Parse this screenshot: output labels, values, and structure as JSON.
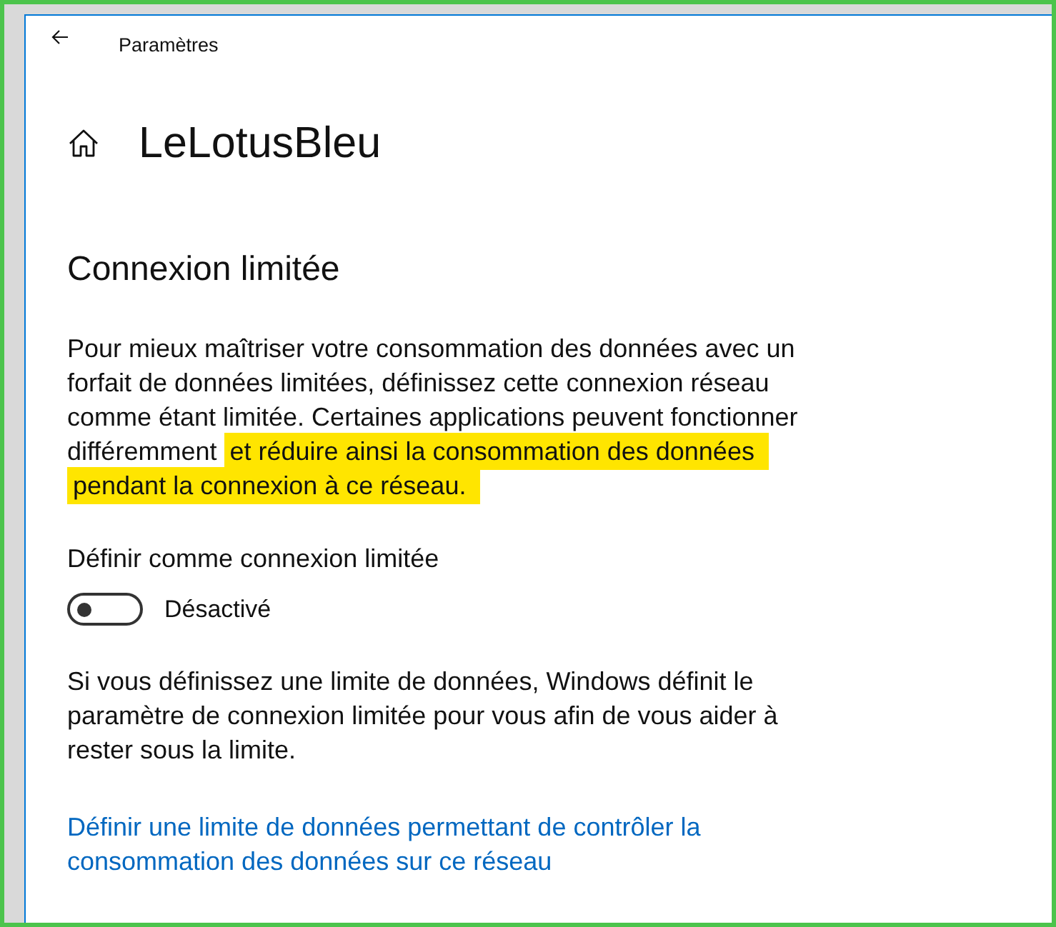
{
  "window": {
    "title": "Paramètres"
  },
  "page": {
    "title": "LeLotusBleu"
  },
  "section": {
    "heading": "Connexion limitée",
    "description": [
      {
        "text": "Pour mieux maîtriser votre consommation des données avec un forfait de données limitées, définissez cette connexion réseau comme étant limitée. Certaines applications peuvent fonctionner différemment",
        "highlighted": false
      },
      {
        "text": "et réduire ainsi la consommation des données pendant la connexion à ce réseau.",
        "highlighted": true
      }
    ],
    "metered_toggle": {
      "label": "Définir comme connexion limitée",
      "on": false,
      "state_text": "Désactivé"
    },
    "note": "Si vous définissez une limite de données, Windows définit le paramètre de connexion limitée pour vous afin de vous aider à rester sous la limite.",
    "link": "Définir une limite de données permettant de contrôler la consommation des données sur ce réseau"
  }
}
